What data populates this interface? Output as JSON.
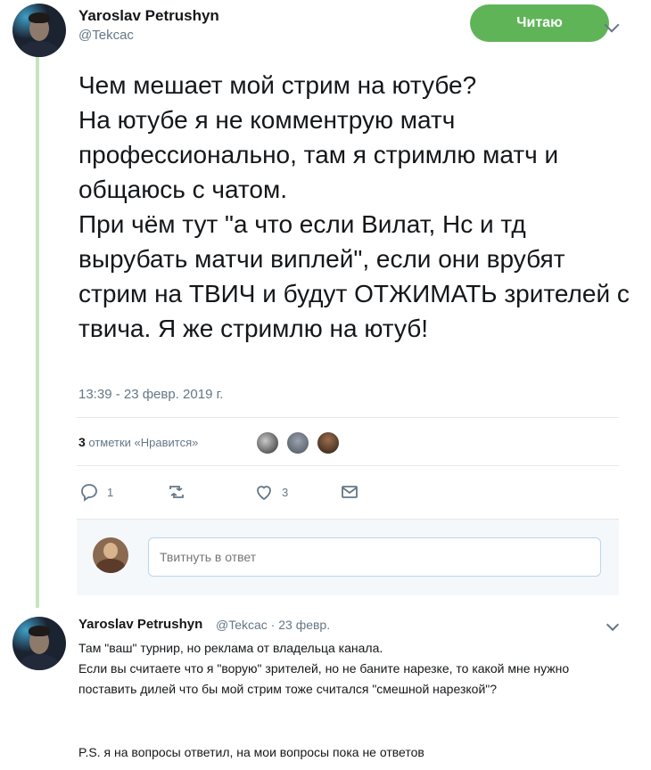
{
  "tweet": {
    "author_name": "Yaroslav Petrushyn",
    "author_handle": "@Tekcac",
    "follow_label": "Читаю",
    "text": "Чем мешает мой стрим на ютубе?\nНа ютубе я не комментрую матч профессионально, там я стримлю матч и общаюсь с чатом.\nПри чём тут \"а что если Вилат, Нс и тд вырубать матчи виплей\", если они врубят стрим на ТВИЧ и будут ОТЖИМАТЬ зрителей с твича. Я же стримлю на ютуб!",
    "timestamp": "13:39 - 23 февр. 2019 г.",
    "likes_count": "3",
    "likes_label": " отметки «Нравится»",
    "actions": {
      "reply_count": "1",
      "retweet_count": "",
      "like_count": "3"
    },
    "icons": [
      "reply-icon",
      "retweet-icon",
      "heart-icon",
      "message-icon",
      "chevron-down-icon"
    ],
    "colors": {
      "follow": "#5fb458",
      "thread_line": "#c7e4c0",
      "muted": "#657786"
    }
  },
  "reply_box": {
    "placeholder": "Твитнуть в ответ"
  },
  "reply": {
    "author_name": "Yaroslav Petrushyn",
    "meta": "@Tekcac · 23 февр.",
    "text": "Там \"ваш\" турнир, но реклама от владельца канала.\nЕсли вы считаете что я \"ворую\" зрителей, но не баните нарезке, то какой мне нужно поставить дилей что бы мой стрим тоже считался \"смешной нарезкой\"?",
    "ps": "P.S. я на вопросы ответил, на мои вопросы пока не ответов"
  }
}
